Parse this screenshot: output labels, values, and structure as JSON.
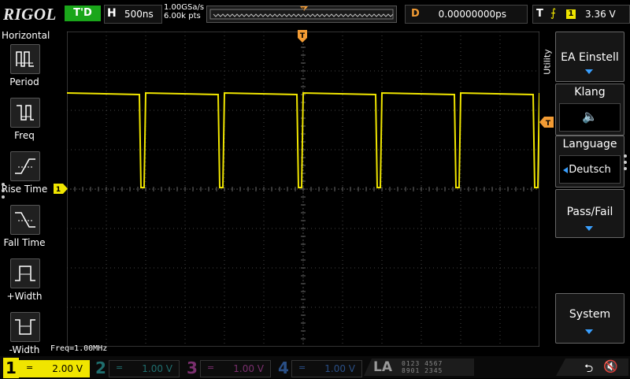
{
  "header": {
    "brand": "RIGOL",
    "run_state": "T'D",
    "horizontal": {
      "label": "H",
      "timebase": "500ns"
    },
    "sample_rate": "1.00GSa/s",
    "memory_depth": "6.00k pts",
    "delay": {
      "label": "D",
      "value": "0.00000000ps"
    },
    "trigger": {
      "label": "T",
      "edge_icon": "rising-edge-icon",
      "source": "1",
      "level": "3.36 V"
    }
  },
  "left_menu": {
    "title": "Horizontal",
    "items": [
      {
        "label": "Period",
        "icon": "period-icon"
      },
      {
        "label": "Freq",
        "icon": "freq-icon"
      },
      {
        "label": "Rise Time",
        "icon": "rise-time-icon"
      },
      {
        "label": "Fall Time",
        "icon": "fall-time-icon"
      },
      {
        "label": "+Width",
        "icon": "positive-width-icon"
      },
      {
        "label": "-Width",
        "icon": "negative-width-icon"
      }
    ]
  },
  "measurement": {
    "freq": "Freq=1.00MHz"
  },
  "right_menu": {
    "tab": "Utility",
    "items": [
      {
        "title": "EA Einstell",
        "has_submenu_arrow": true
      },
      {
        "title": "Klang",
        "sub_icon": "speaker-icon"
      },
      {
        "title": "Language",
        "value": "Deutsch"
      },
      {
        "title": "Pass/Fail",
        "has_submenu_arrow": true
      },
      {
        "title": "System",
        "has_submenu_arrow": true
      }
    ]
  },
  "channels": [
    {
      "num": "1",
      "coupling": "=",
      "scale": "2.00 V",
      "active": true,
      "color": "#f0e500"
    },
    {
      "num": "2",
      "coupling": "=",
      "scale": "1.00 V",
      "active": false,
      "color": "#1f6e6e"
    },
    {
      "num": "3",
      "coupling": "=",
      "scale": "1.00 V",
      "active": false,
      "color": "#7a2f6e"
    },
    {
      "num": "4",
      "coupling": "=",
      "scale": "1.00 V",
      "active": false,
      "color": "#2a4f86"
    }
  ],
  "la": {
    "label": "LA",
    "bits_row1": "0123 4567",
    "bits_row2": "8901 2345"
  },
  "status": {
    "usb_icon": "usb-icon",
    "sound_icon": "speaker-muted-icon"
  },
  "markers": {
    "trigger_position": "T",
    "trigger_level": "T",
    "ch1_ground": "1"
  },
  "colors": {
    "ch1": "#f0e500",
    "trigger": "#f39c34",
    "run_state": "#1aa61a"
  }
}
